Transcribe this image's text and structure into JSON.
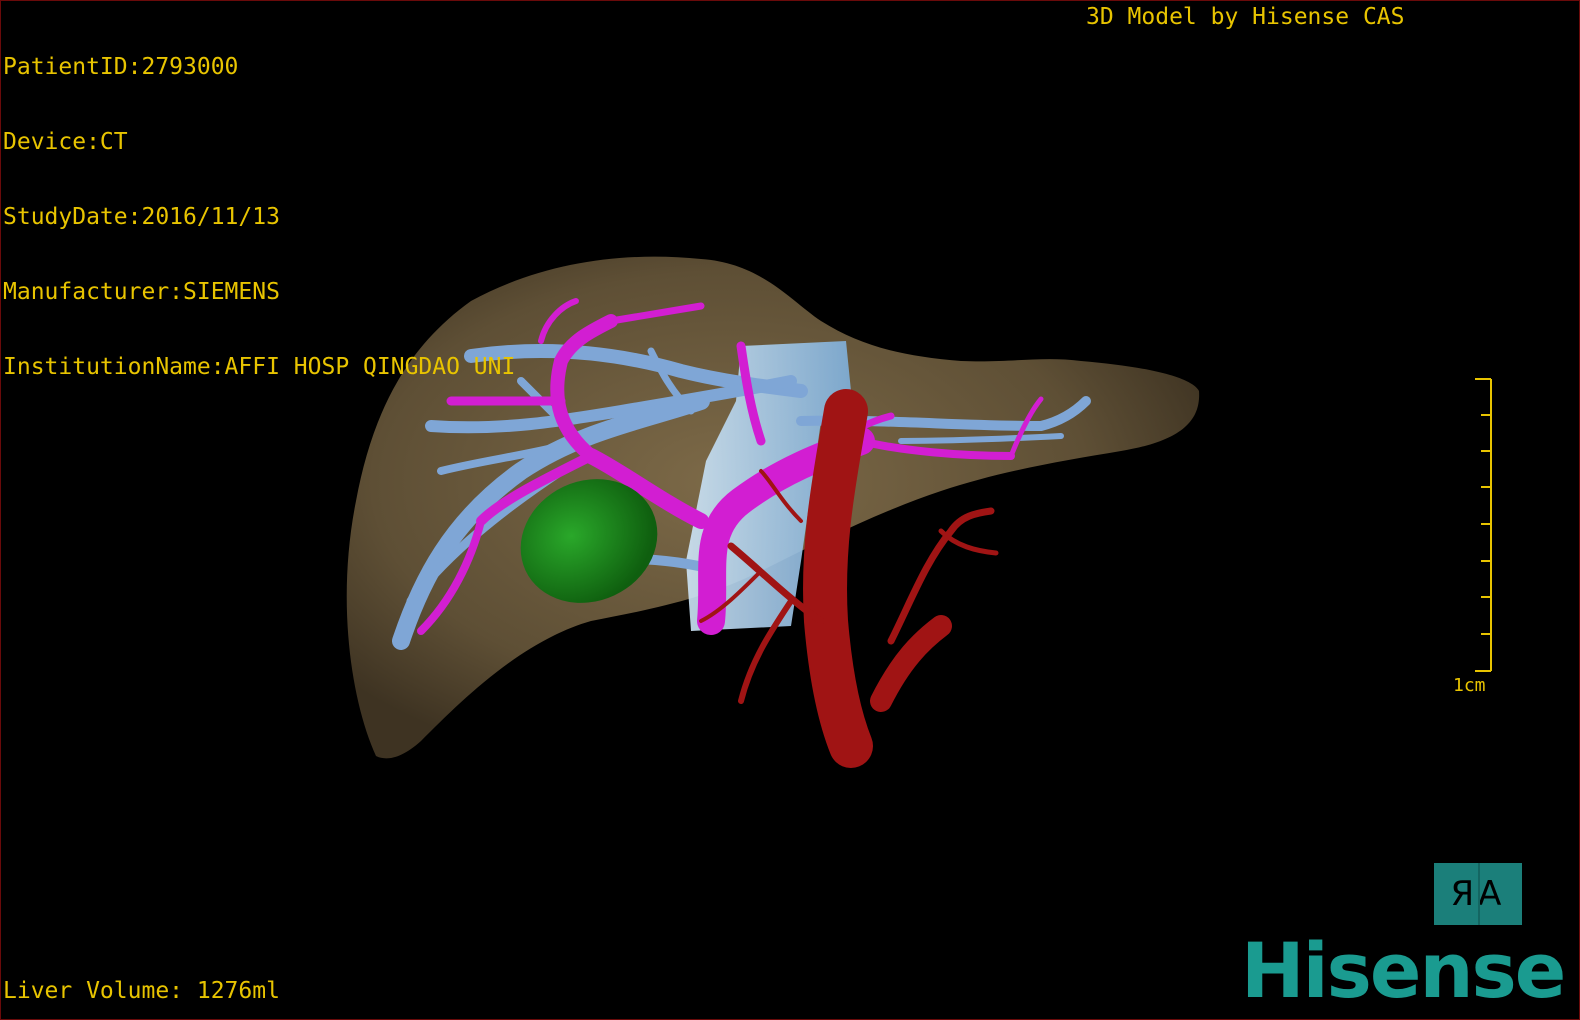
{
  "overlay": {
    "patient_id": "PatientID:2793000",
    "device": "Device:CT",
    "study_date": "StudyDate:2016/11/13",
    "manufacturer": "Manufacturer:SIEMENS",
    "institution": "InstitutionName:AFFI HOSP QINGDAO UNI",
    "credit": "3D Model by Hisense CAS",
    "liver_volume": "Liver Volume: 1276ml"
  },
  "scale": {
    "label": "1cm"
  },
  "orientation_button": {
    "label": "ЯA"
  },
  "brand": {
    "logo_text": "Hisense"
  },
  "colors": {
    "overlay_text": "#e8c400",
    "liver": "#6b5a3e",
    "hepatic_vein": "#7fa6d6",
    "portal_vein": "#d21ed2",
    "gallbladder": "#1a8c1a",
    "artery": "#a01414",
    "vena_cava": "#a8d0f0",
    "brand": "#1a9b90"
  }
}
